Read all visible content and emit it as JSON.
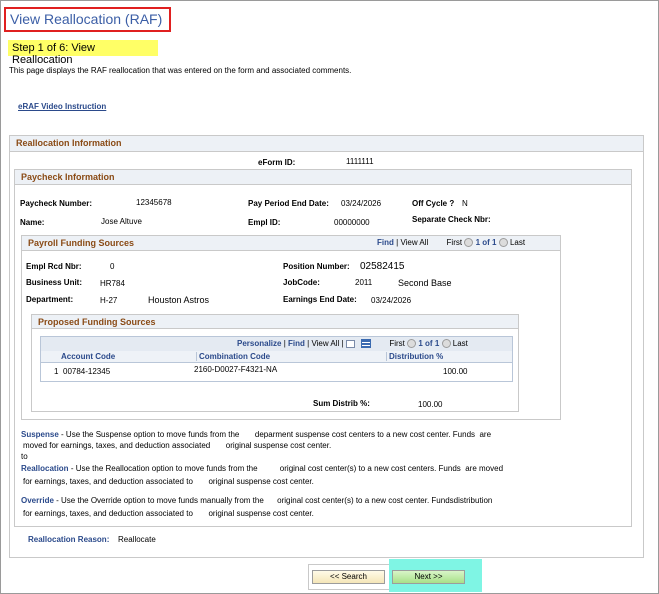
{
  "page": {
    "title": "View Reallocation (RAF)",
    "step": "Step 1 of 6: View Reallocation",
    "description": "This page displays the RAF reallocation that was entered on the form and associated comments.",
    "video_link": "eRAF Video Instruction"
  },
  "reallocation": {
    "header": "Reallocation Information",
    "eform_label": "eForm ID:",
    "eform_value": "1111111"
  },
  "paycheck": {
    "header": "Paycheck Information",
    "paycheck_number_label": "Paycheck Number:",
    "paycheck_number": "12345678",
    "pay_period_end_label": "Pay Period End Date:",
    "pay_period_end": "03/24/2026",
    "off_cycle_label": "Off Cycle ?",
    "off_cycle": "N",
    "name_label": "Name:",
    "name": "Jose Altuve",
    "empl_id_label": "Empl ID:",
    "empl_id": "00000000",
    "separate_check_label": "Separate Check Nbr:"
  },
  "payroll": {
    "header": "Payroll Funding Sources",
    "find": "Find",
    "view_all": "View All",
    "first": "First",
    "paging": "1 of 1",
    "last": "Last",
    "empl_rcd_label": "Empl Rcd Nbr:",
    "empl_rcd": "0",
    "position_label": "Position Number:",
    "position": "02582415",
    "business_unit_label": "Business Unit:",
    "business_unit": "HR784",
    "jobcode_label": "JobCode:",
    "jobcode": "2011",
    "jobcode_desc": "Second Base",
    "department_label": "Department:",
    "department": "H-27",
    "department_desc": "Houston Astros",
    "earnings_end_label": "Earnings End Date:",
    "earnings_end": "03/24/2026"
  },
  "proposed": {
    "header": "Proposed Funding Sources",
    "personalize": "Personalize",
    "find": "Find",
    "view_all": "View All",
    "first": "First",
    "paging": "1 of 1",
    "last": "Last",
    "columns": [
      "Account Code",
      "Combination Code",
      "Distribution %"
    ],
    "rows": [
      {
        "num": "1",
        "account": "00784-12345",
        "combination": "2160-D0027-F4321-NA",
        "distribution": "100.00"
      }
    ],
    "sum_label": "Sum Distrib %:",
    "sum_value": "100.00"
  },
  "options": {
    "suspense_name": "Suspense",
    "suspense_text1": "- Use the Suspense option to move funds from the       deparment suspense cost centers to a new cost center. Funds  are",
    "suspense_text2": "moved for earnings, taxes, and deduction associated       original suspense cost center.",
    "suspense_text3": "to",
    "reallocation_name": "Reallocation",
    "reallocation_text1": "- Use the Reallocation option to move funds from the          original cost center(s) to a new cost centers. Funds  are moved",
    "reallocation_text2": "for earnings, taxes, and deduction associated to       original suspense cost center.",
    "override_name": "Override",
    "override_text1": "- Use the Override option to move funds manually from the      original cost center(s) to a new cost center. Fundsdistribution",
    "override_text2": "for earnings, taxes, and deduction associated to       original suspense cost center."
  },
  "reason": {
    "label": "Reallocation Reason:",
    "value": "Reallocate"
  },
  "buttons": {
    "search": "<< Search",
    "next": "Next >>"
  }
}
